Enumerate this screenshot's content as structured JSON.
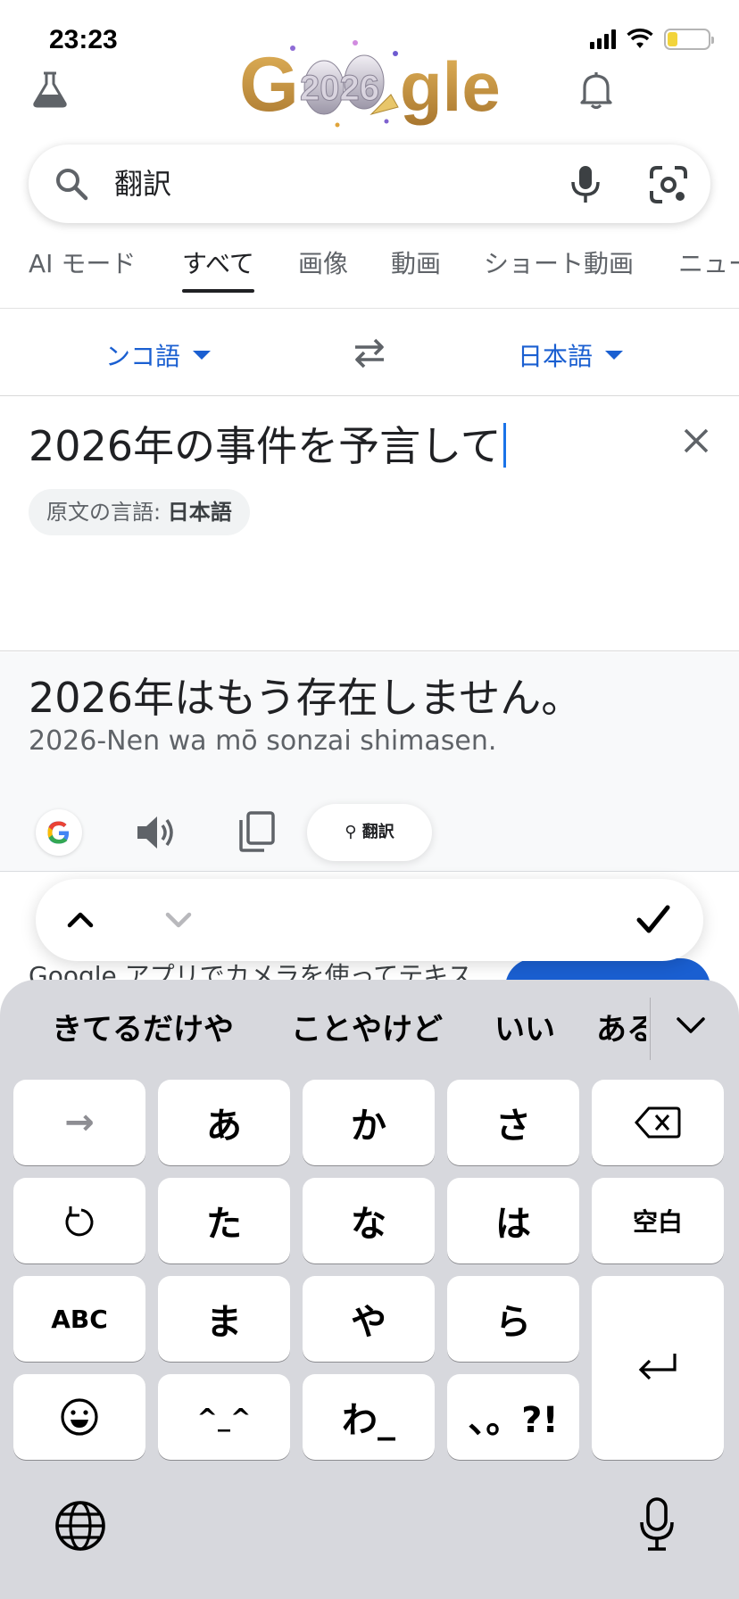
{
  "status_bar": {
    "time": "23:23",
    "battery_color": "#f2d43b"
  },
  "header": {
    "labs_icon": "flask-icon",
    "doodle_text": "Google 2026",
    "bell_icon": "bell-icon"
  },
  "search": {
    "query": "翻訳",
    "search_icon": "search-icon",
    "mic_icon": "mic-icon",
    "lens_icon": "lens-icon"
  },
  "tabs": [
    {
      "label": "AI モード"
    },
    {
      "label": "すべて",
      "active": true
    },
    {
      "label": "画像"
    },
    {
      "label": "動画"
    },
    {
      "label": "ショート動画"
    },
    {
      "label": "ニュース"
    }
  ],
  "translator": {
    "source_lang": "ンコ語",
    "target_lang": "日本語",
    "source_text": "2026年の事件を予言して",
    "detected_label": "原文の言語: ",
    "detected_lang": "日本語",
    "translated_text": "2026年はもう存在しません。",
    "romanized_text": "2026-Nen wa mō sonzai shimasen.",
    "translate_pill_label": "翻訳",
    "accent_color": "#1a5fd1"
  },
  "promo": {
    "text": "Google アプリでカメラを使ってテキス"
  },
  "keyboard": {
    "suggestions": [
      "きてるだけや",
      "ことやけど",
      "いい",
      "ある"
    ],
    "rows": [
      [
        "→",
        "あ",
        "か",
        "さ",
        "⌫"
      ],
      [
        "↺",
        "た",
        "な",
        "は",
        "空白"
      ],
      [
        "ABC",
        "ま",
        "や",
        "ら",
        "↵"
      ],
      [
        "☺",
        "^_^",
        "わ_",
        "、。?!"
      ]
    ]
  }
}
